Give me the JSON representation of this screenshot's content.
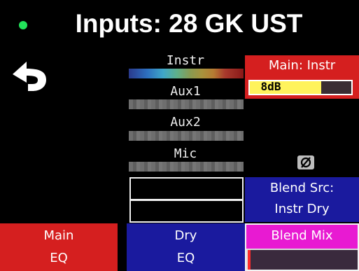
{
  "header": {
    "title": "Inputs: 28 GK UST",
    "status_color": "#22e35a"
  },
  "back": {
    "icon": "back-arrow-icon"
  },
  "meters": [
    {
      "label": "Instr",
      "style": "spectrum"
    },
    {
      "label": "Aux1",
      "style": "gray"
    },
    {
      "label": "Aux2",
      "style": "gray"
    },
    {
      "label": "Mic",
      "style": "gray"
    }
  ],
  "main_instr": {
    "label": "Main: Instr",
    "gain_value": "8dB",
    "gain_level_fraction": 0.7
  },
  "phase": {
    "icon": "phase-invert-icon",
    "glyph": "Ø"
  },
  "blend_source": {
    "line1": "Blend Src:",
    "line2": "Instr Dry"
  },
  "buttons": {
    "main_eq": {
      "line1": "Main",
      "line2": "EQ"
    },
    "dry_eq": {
      "line1": "Dry",
      "line2": "EQ"
    },
    "blend_mix": {
      "label": "Blend Mix",
      "level_fraction": 0.02
    }
  },
  "colors": {
    "red": "#d51f1f",
    "blue": "#1a1a9e",
    "magenta": "#e81ad2",
    "yellow": "#fff35c"
  }
}
